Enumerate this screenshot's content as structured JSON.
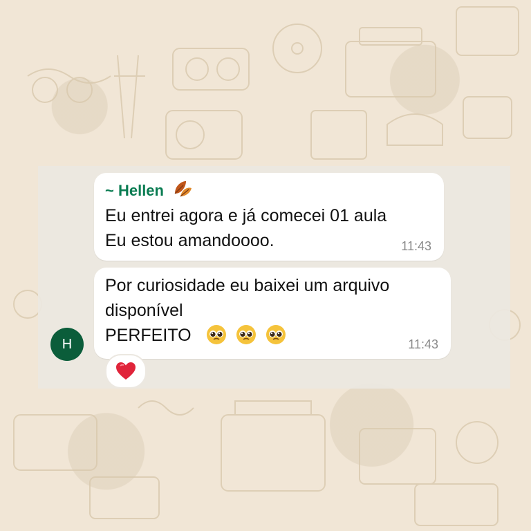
{
  "messages": [
    {
      "sender": "~ Hellen",
      "sender_icon": "autumn-leaves-icon",
      "lines": [
        "Eu entrei agora e já comecei 01 aula",
        "Eu estou amandoooo."
      ],
      "time": "11:43"
    },
    {
      "lines": [
        "Por curiosidade eu baixei um arquivo",
        "disponível",
        "PERFEITO"
      ],
      "emoji": [
        "pleading-face-icon",
        "pleading-face-icon",
        "pleading-face-icon"
      ],
      "time": "11:43"
    }
  ],
  "avatar": {
    "initial": "H",
    "color": "#0b5d3a"
  },
  "reaction": {
    "icon": "red-heart-icon",
    "color": "#e0243a"
  },
  "colors": {
    "sender_name": "#0a7c52",
    "bubble": "#ffffff",
    "timestamp": "#8a8a8a",
    "wallpaper": "#f1e6d6"
  }
}
